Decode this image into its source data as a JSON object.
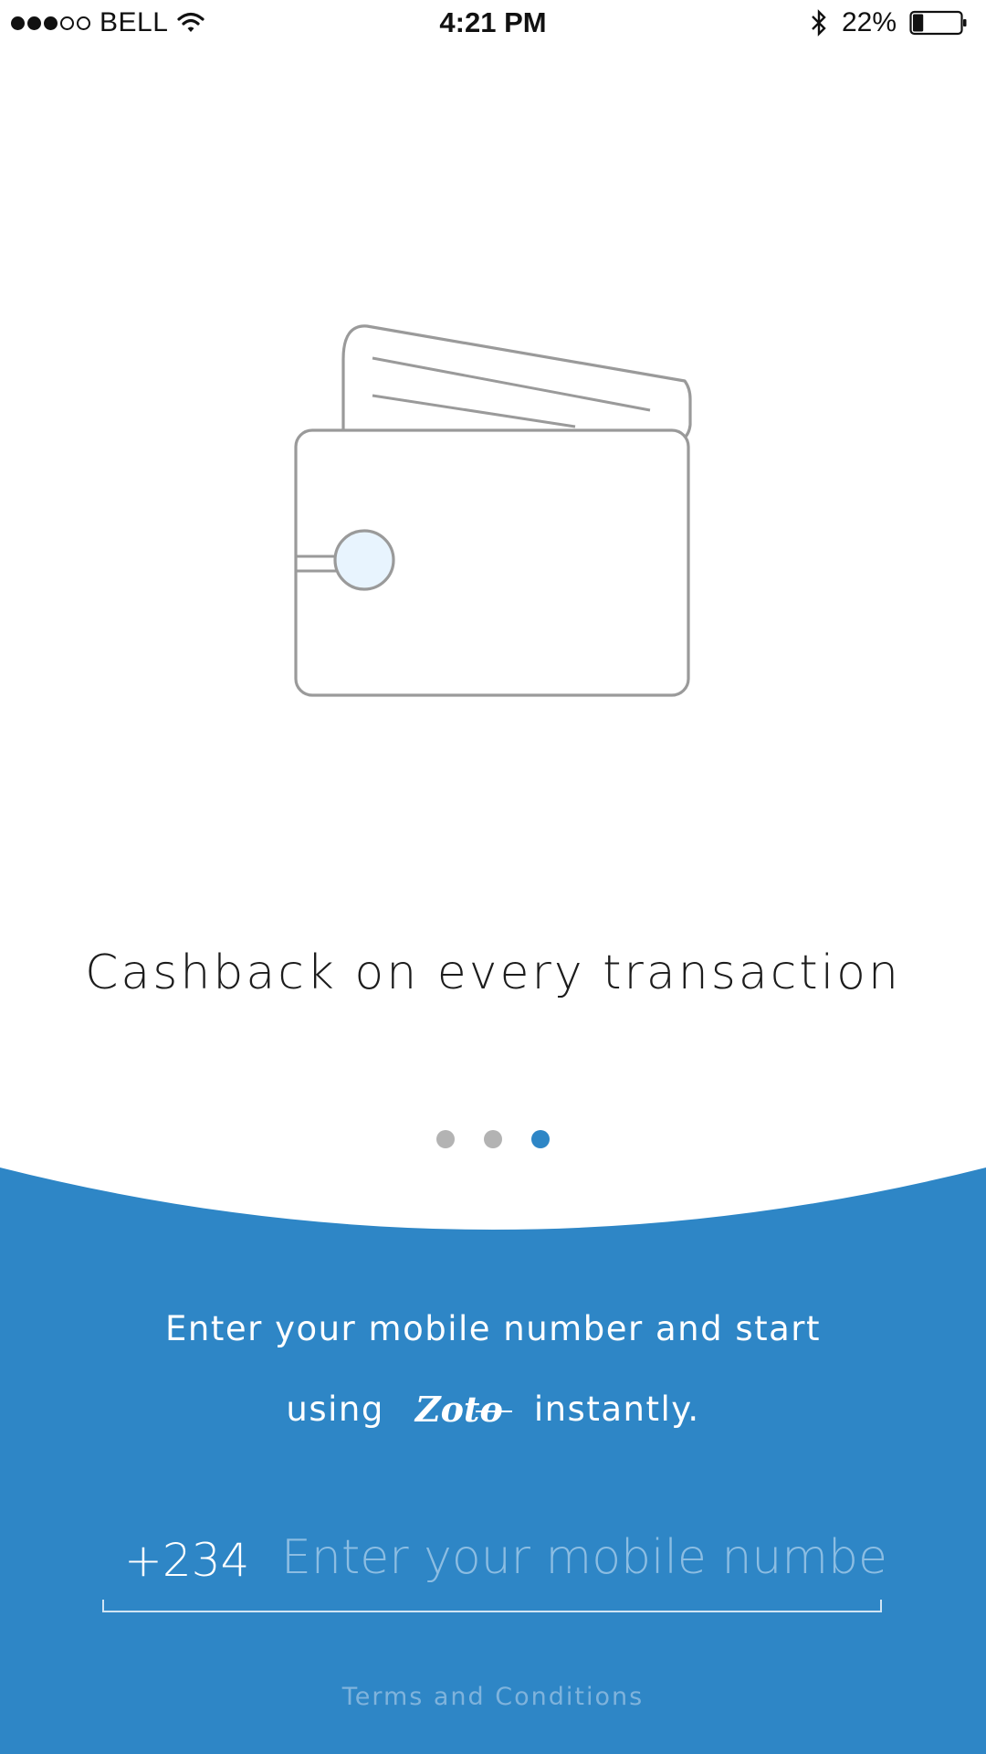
{
  "status_bar": {
    "carrier": "BELL",
    "time": "4:21 PM",
    "battery_percent": "22%",
    "battery_level": 0.22,
    "signal_bars_filled": 3,
    "signal_bars_total": 5,
    "icons": [
      "wifi-icon",
      "bluetooth-icon",
      "battery-icon"
    ]
  },
  "onboarding": {
    "slide_title": "Cashback on every transaction",
    "illustration": "wallet-icon",
    "pager": {
      "total": 3,
      "active_index": 2
    }
  },
  "signup": {
    "intro_line1": "Enter your mobile number and start",
    "intro_using": "using",
    "brand": "Zoto",
    "intro_instantly": "instantly.",
    "country_code": "+234",
    "phone_value": "",
    "phone_placeholder": "Enter your mobile number",
    "terms_label": "Terms and Conditions"
  },
  "colors": {
    "brand_blue": "#2e86c6",
    "pager_inactive": "#b3b3b3",
    "wallet_stroke": "#9a9a9a",
    "wallet_clasp": "#e8f4fe"
  }
}
